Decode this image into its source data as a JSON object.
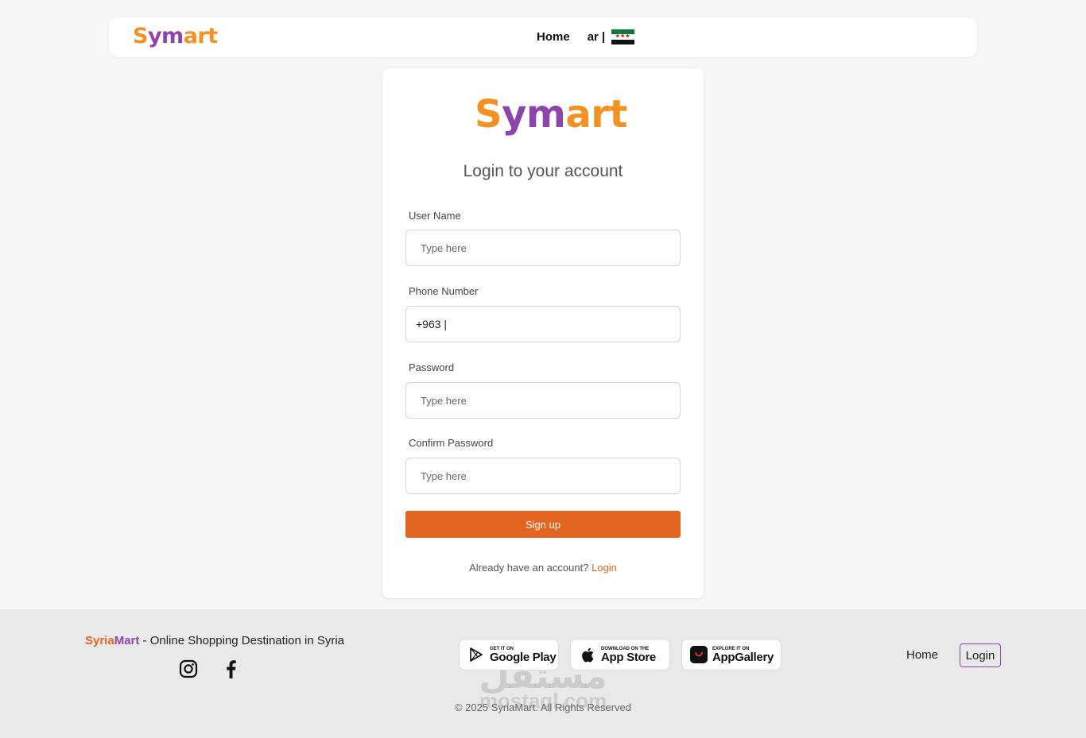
{
  "header": {
    "logo": {
      "s": "S",
      "ym": "ym",
      "ar": "ar",
      "t": "t"
    },
    "nav_home": "Home",
    "nav_lang": "ar |"
  },
  "login_card": {
    "logo": {
      "s": "S",
      "ym": "ym",
      "ar": "ar",
      "t": "t"
    },
    "title": "Login to your account",
    "username": {
      "label": "User Name",
      "placeholder": "Type here"
    },
    "phone": {
      "label": "Phone Number",
      "value": "+963 |"
    },
    "password": {
      "label": "Password",
      "placeholder": "Type here"
    },
    "confirm_password": {
      "label": "Confirm Password",
      "placeholder": "Type here"
    },
    "signup_button": "Sign up",
    "already_text": "Already have an account?",
    "login_link": "Login"
  },
  "footer": {
    "brand_part1": "Syria",
    "brand_part2": "Mart",
    "tagline": " - Online Shopping Destination in Syria",
    "social": [
      "instagram-icon",
      "facebook-icon"
    ],
    "stores": [
      {
        "small": "GET IT ON",
        "big": "Google Play",
        "icon": "google-play-icon"
      },
      {
        "small": "Download on the",
        "big": "App Store",
        "icon": "apple-icon"
      },
      {
        "small": "EXPLORE IT ON",
        "big": "AppGallery",
        "icon": "huawei-icon"
      }
    ],
    "links": {
      "home": "Home",
      "login": "Login"
    },
    "watermark_ar": "مستقل",
    "watermark_lat": "mostaql.com",
    "copyright": "© 2025 SyriaMart. All Rights Reserved"
  },
  "colors": {
    "accent_orange": "#e4651f",
    "logo_orange": "#f39223",
    "logo_purple": "#8e44ad"
  }
}
